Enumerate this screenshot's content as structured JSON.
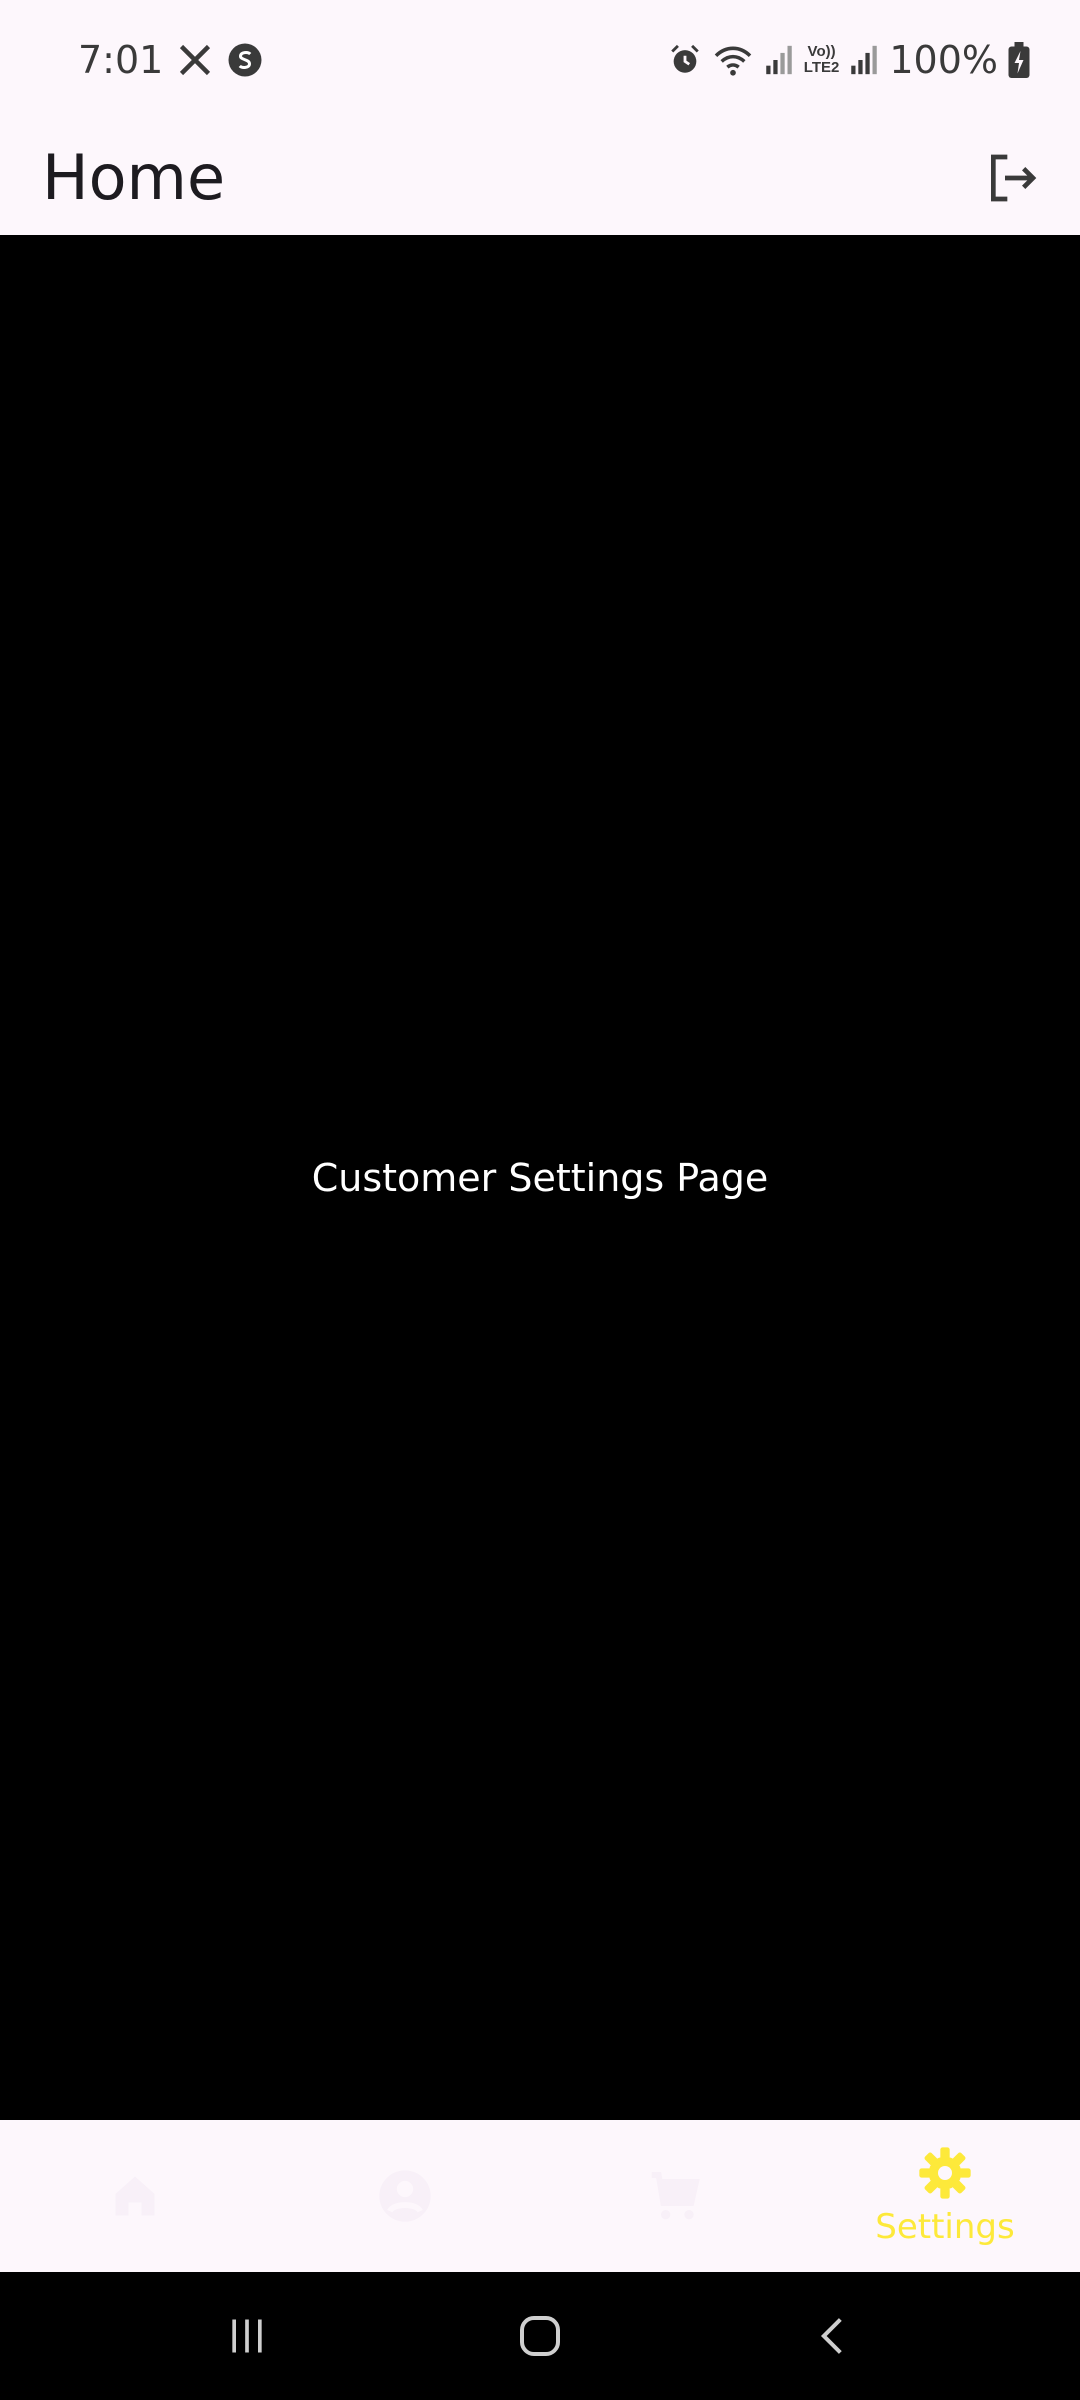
{
  "status_bar": {
    "time": "7:01",
    "left_icons": [
      "x-logo-icon",
      "s-app-icon"
    ],
    "right_icons": [
      "alarm-icon",
      "wifi-icon",
      "signal-icon",
      "volte-lte-icon",
      "signal-icon"
    ],
    "lte_line1": "Vo))",
    "lte_line2": "LTE2",
    "battery": "100%"
  },
  "app_bar": {
    "title": "Home",
    "logout_icon": "logout-icon"
  },
  "main": {
    "text": "Customer Settings Page"
  },
  "bottom_nav": {
    "items": [
      {
        "icon": "home-icon",
        "label": "",
        "active": false
      },
      {
        "icon": "person-icon",
        "label": "",
        "active": false
      },
      {
        "icon": "cart-icon",
        "label": "",
        "active": false
      },
      {
        "icon": "gear-icon",
        "label": "Settings",
        "active": true
      }
    ],
    "active_color": "#fde93a",
    "inactive_color": "#f8f0f8"
  },
  "system_nav": {
    "buttons": [
      "recents-icon",
      "home-circle-icon",
      "back-icon"
    ]
  },
  "colors": {
    "surface": "#fdf7fc",
    "content_bg": "#000000",
    "accent": "#fde93a"
  }
}
